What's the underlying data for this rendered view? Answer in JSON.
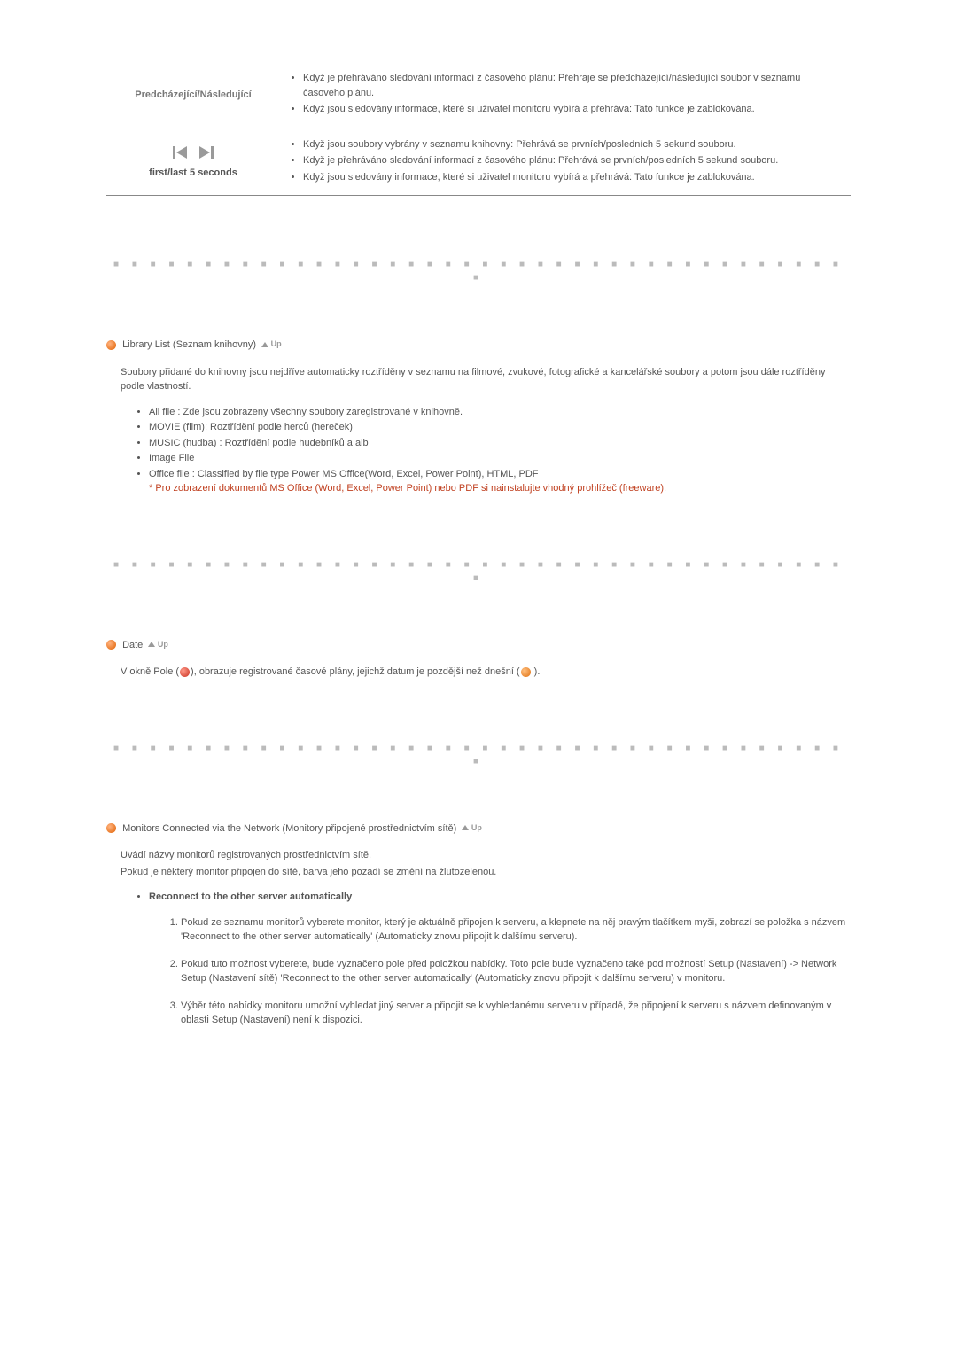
{
  "table": {
    "row1": {
      "label": "Predcházející/Následující",
      "item1": "Když je přehráváno sledování informací z časového plánu: Přehraje se předcházející/následující soubor v seznamu časového plánu.",
      "item2": "Když jsou sledovány informace, které si uživatel monitoru vybírá a přehrává: Tato funkce je zablokována."
    },
    "row2": {
      "label": "first/last 5 seconds",
      "item1": "Když jsou soubory vybrány v seznamu knihovny: Přehrává se prvních/posledních 5 sekund souboru.",
      "item2": "Když je přehráváno sledování informací z časového plánu: Přehrává se prvních/posledních 5 sekund souboru.",
      "item3": "Když jsou sledovány informace, které si uživatel monitoru vybírá a přehrává: Tato funkce je zablokována."
    }
  },
  "sectionA": {
    "title": "Library List (Seznam knihovny)",
    "up": "Up",
    "intro": "Soubory přidané do knihovny jsou nejdříve automaticky roztříděny v seznamu na filmové, zvukové, fotografické a kancelářské soubory a potom jsou dále roztříděny podle vlastností.",
    "li1": "All file : Zde jsou zobrazeny všechny soubory zaregistrované v knihovně.",
    "li2": "MOVIE (film): Roztřídění podle herců (hereček)",
    "li3": "MUSIC (hudba) : Roztřídění podle hudebníků a alb",
    "li4": "Image File",
    "li5": "Office file : Classified by file type Power MS Office(Word, Excel, Power Point), HTML, PDF",
    "li5warn": "* Pro zobrazení dokumentů MS Office (Word, Excel, Power Point) nebo PDF si nainstalujte vhodný prohlížeč (freeware)."
  },
  "sectionB": {
    "title": "Date",
    "up": "Up",
    "pre": "V okně Pole (",
    "mid": "), obrazuje registrované časové plány, jejichž datum je pozdější než dnešní (",
    "post": " )."
  },
  "sectionC": {
    "title": "Monitors Connected via the Network (Monitory připojené prostřednictvím sítě)",
    "up": "Up",
    "p1": "Uvádí názvy monitorů registrovaných prostřednictvím sítě.",
    "p2": "Pokud je některý monitor připojen do sítě, barva jeho pozadí se změní na žlutozelenou.",
    "reconnect_heading": "Reconnect to the other server automatically",
    "step1": "Pokud ze seznamu monitorů vyberete monitor, který je aktuálně připojen k serveru, a klepnete na něj pravým tlačítkem myši, zobrazí se položka s názvem 'Reconnect to the other server automatically' (Automaticky znovu připojit k dalšímu serveru).",
    "step2": "Pokud tuto možnost vyberete, bude vyznačeno pole před položkou nabídky. Toto pole bude vyznačeno také pod možností Setup (Nastavení) -> Network Setup (Nastavení sítě) 'Reconnect to the other server automatically' (Automaticky znovu připojit k dalšímu serveru) v monitoru.",
    "step3": "Výběr této nabídky monitoru umožní vyhledat jiný server a připojit se k vyhledanému serveru v případě, že připojení k serveru s názvem definovaným v oblasti Setup (Nastavení) není k dispozici."
  }
}
